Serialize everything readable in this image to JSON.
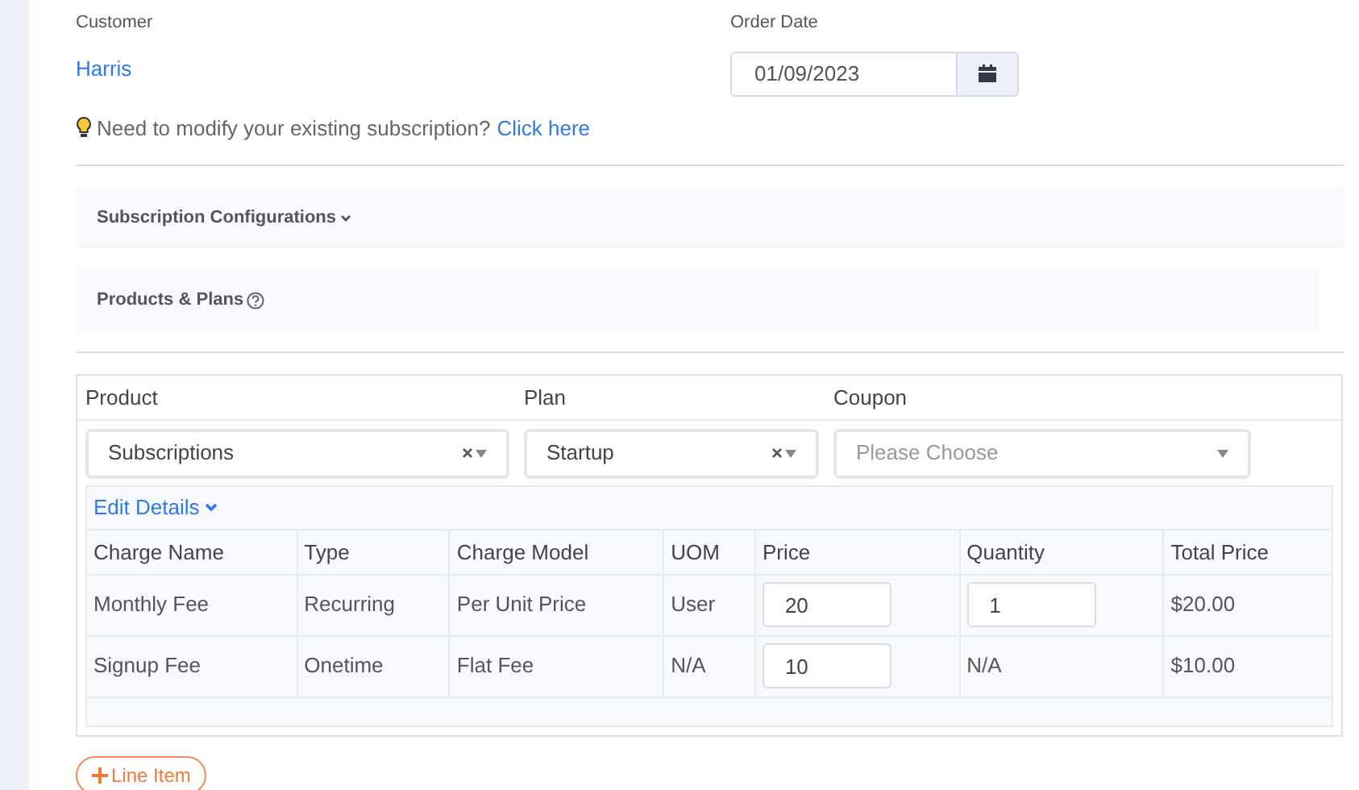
{
  "customer": {
    "label": "Customer",
    "value": "Harris"
  },
  "order_date": {
    "label": "Order Date",
    "value": "01/09/2023"
  },
  "notice": {
    "text": "Need to modify your existing subscription?",
    "link": "Click here"
  },
  "sections": [
    {
      "title": "Subscription Configurations",
      "kind": "collapsible"
    },
    {
      "title": "Products & Plans",
      "kind": "help"
    }
  ],
  "line": {
    "fields": [
      {
        "label": "Product",
        "value": "Subscriptions",
        "clearable": true
      },
      {
        "label": "Plan",
        "value": "Startup",
        "clearable": true
      },
      {
        "label": "Coupon",
        "placeholder": "Please Choose",
        "clearable": false
      }
    ],
    "edit_details": "Edit Details",
    "columns": [
      "Charge Name",
      "Type",
      "Charge Model",
      "UOM",
      "Price",
      "Quantity",
      "Total Price"
    ],
    "rows": [
      [
        {
          "kind": "text",
          "value": "Monthly Fee"
        },
        {
          "kind": "text",
          "value": "Recurring"
        },
        {
          "kind": "text",
          "value": "Per Unit Price"
        },
        {
          "kind": "text",
          "value": "User"
        },
        {
          "kind": "input",
          "value": "20"
        },
        {
          "kind": "input",
          "value": "1"
        },
        {
          "kind": "text",
          "value": "$20.00"
        }
      ],
      [
        {
          "kind": "text",
          "value": "Signup Fee"
        },
        {
          "kind": "text",
          "value": "Onetime"
        },
        {
          "kind": "text",
          "value": "Flat Fee"
        },
        {
          "kind": "text",
          "value": "N/A"
        },
        {
          "kind": "input",
          "value": "10"
        },
        {
          "kind": "text",
          "value": "N/A"
        },
        {
          "kind": "text",
          "value": "$10.00"
        }
      ]
    ]
  },
  "add_button": "Line Item"
}
